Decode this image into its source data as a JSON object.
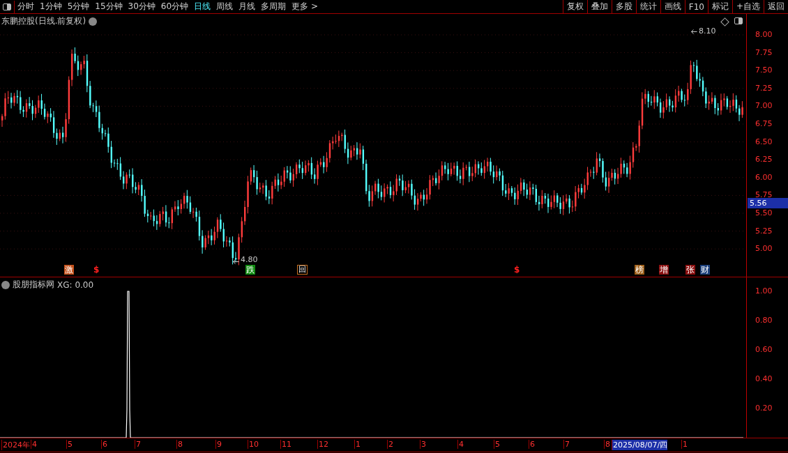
{
  "toolbar": {
    "periods": [
      {
        "label": "分时",
        "selected": false
      },
      {
        "label": "1分钟",
        "selected": false
      },
      {
        "label": "5分钟",
        "selected": false
      },
      {
        "label": "15分钟",
        "selected": false
      },
      {
        "label": "30分钟",
        "selected": false
      },
      {
        "label": "60分钟",
        "selected": false
      },
      {
        "label": "日线",
        "selected": true
      },
      {
        "label": "周线",
        "selected": false
      },
      {
        "label": "月线",
        "selected": false
      },
      {
        "label": "多周期",
        "selected": false
      },
      {
        "label": "更多 >",
        "selected": false
      }
    ],
    "buttons": [
      "复权",
      "叠加",
      "多股",
      "统计",
      "画线",
      "F10",
      "标记",
      "+自选",
      "返回"
    ]
  },
  "price_chart": {
    "title": "东鹏控股(日线.前复权)",
    "y_labels": [
      "8.00",
      "7.75",
      "7.50",
      "7.25",
      "7.00",
      "6.75",
      "6.50",
      "6.25",
      "6.00",
      "5.75",
      "5.50",
      "5.25",
      "5.00"
    ],
    "current_price": "5.56",
    "high_label": "8.10",
    "low_label": "4.80",
    "signals": [
      {
        "label": "激",
        "kind": "box",
        "color": "#c4501a"
      },
      {
        "label": "$",
        "kind": "dollar",
        "color": "#ff2020"
      },
      {
        "label": "跌",
        "kind": "box",
        "color": "#108a10"
      },
      {
        "label": "回",
        "kind": "outline",
        "color": "#c87020"
      },
      {
        "label": "$",
        "kind": "dollar",
        "color": "#ff2020"
      },
      {
        "label": "榜",
        "kind": "box",
        "color": "#a0601a"
      },
      {
        "label": "增",
        "kind": "box",
        "color": "#8b1010"
      },
      {
        "label": "张",
        "kind": "box",
        "color": "#8b1010"
      },
      {
        "label": "财",
        "kind": "box",
        "color": "#1a3e7a"
      }
    ]
  },
  "indicator_chart": {
    "title": "股朋指标网",
    "reading": "XG: 0.00",
    "y_labels": [
      "1.00",
      "0.80",
      "0.60",
      "0.40",
      "0.20"
    ]
  },
  "time_axis": {
    "labels": [
      {
        "text": "2024年",
        "selected": false
      },
      {
        "text": "4",
        "selected": false
      },
      {
        "text": "5",
        "selected": false
      },
      {
        "text": "6",
        "selected": false
      },
      {
        "text": "7",
        "selected": false
      },
      {
        "text": "8",
        "selected": false
      },
      {
        "text": "9",
        "selected": false
      },
      {
        "text": "10",
        "selected": false
      },
      {
        "text": "11",
        "selected": false
      },
      {
        "text": "12",
        "selected": false
      },
      {
        "text": "1",
        "selected": false
      },
      {
        "text": "2",
        "selected": false
      },
      {
        "text": "3",
        "selected": false
      },
      {
        "text": "4",
        "selected": false
      },
      {
        "text": "5",
        "selected": false
      },
      {
        "text": "6",
        "selected": false
      },
      {
        "text": "7",
        "selected": false
      },
      {
        "text": "8",
        "selected": false
      },
      {
        "text": "2025/08/07/四",
        "selected": true
      },
      {
        "text": "1",
        "selected": false
      }
    ]
  }
}
